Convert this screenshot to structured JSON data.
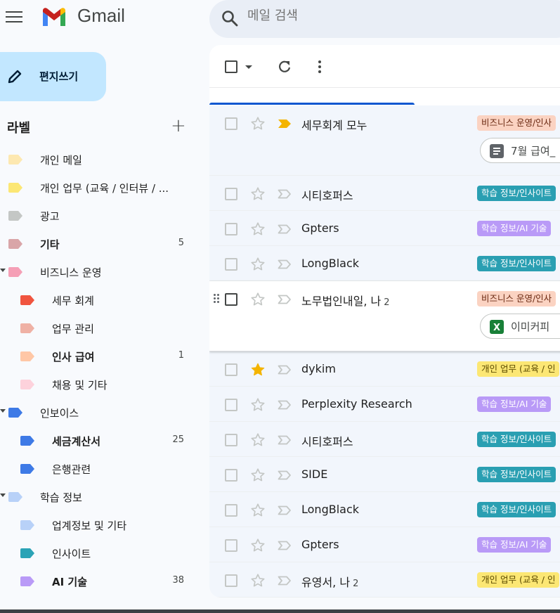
{
  "app": {
    "title": "Gmail"
  },
  "search": {
    "placeholder": "메일 검색"
  },
  "compose": {
    "label": "편지쓰기"
  },
  "labels": {
    "title": "라벨",
    "items": [
      {
        "name": "개인 메일",
        "color": "#fde8b0",
        "indent": false,
        "caret": false,
        "bold": false,
        "count": ""
      },
      {
        "name": "개인 업무 (교육 / 인터뷰 / ...",
        "color": "#fce774",
        "indent": false,
        "caret": false,
        "bold": false,
        "count": ""
      },
      {
        "name": "광고",
        "color": "#c4c7c5",
        "indent": false,
        "caret": false,
        "bold": false,
        "count": ""
      },
      {
        "name": "기타",
        "color": "#d9a5a8",
        "indent": false,
        "caret": false,
        "bold": true,
        "count": "5"
      },
      {
        "name": "비즈니스 운영",
        "color": "#f59fb6",
        "indent": false,
        "caret": true,
        "bold": false,
        "count": ""
      },
      {
        "name": "세무 회계",
        "color": "#f0543f",
        "indent": true,
        "caret": false,
        "bold": false,
        "count": ""
      },
      {
        "name": "업무 관리",
        "color": "#efb1a5",
        "indent": true,
        "caret": false,
        "bold": false,
        "count": ""
      },
      {
        "name": "인사 급여",
        "color": "#ffc7a6",
        "indent": true,
        "caret": false,
        "bold": true,
        "count": "1"
      },
      {
        "name": "채용 및 기타",
        "color": "#fdd2dc",
        "indent": true,
        "caret": false,
        "bold": false,
        "count": ""
      },
      {
        "name": "인보이스",
        "color": "#3e7ae6",
        "indent": false,
        "caret": true,
        "bold": false,
        "count": ""
      },
      {
        "name": "세금계산서",
        "color": "#3e7ae6",
        "indent": true,
        "caret": false,
        "bold": true,
        "count": "25"
      },
      {
        "name": "은행관련",
        "color": "#3e7ae6",
        "indent": true,
        "caret": false,
        "bold": false,
        "count": ""
      },
      {
        "name": "학습 정보",
        "color": "#b8d1f8",
        "indent": false,
        "caret": true,
        "bold": false,
        "count": ""
      },
      {
        "name": "업계정보 및 기타",
        "color": "#b8d1f8",
        "indent": true,
        "caret": false,
        "bold": false,
        "count": ""
      },
      {
        "name": "인사이트",
        "color": "#2ba3b6",
        "indent": true,
        "caret": false,
        "bold": false,
        "count": ""
      },
      {
        "name": "AI 기술",
        "color": "#b99af7",
        "indent": true,
        "caret": false,
        "bold": true,
        "count": "38"
      }
    ]
  },
  "emails": [
    {
      "sender": "세무회계 모누",
      "count": "",
      "starred": false,
      "important": true,
      "label": "비즈니스 운영/인사",
      "label_bg": "#fbd3c2",
      "label_fg": "#6b2a12",
      "attachment": "7월 급여_",
      "attachment_type": "doc",
      "hover": false
    },
    {
      "sender": "시티호퍼스",
      "count": "",
      "starred": false,
      "important": false,
      "label": "학습 정보/인사이트",
      "label_bg": "#2a9fb2",
      "label_fg": "#ffffff",
      "attachment": "",
      "attachment_type": "",
      "hover": false
    },
    {
      "sender": "Gpters",
      "count": "",
      "starred": false,
      "important": false,
      "label": "학습 정보/AI 기술",
      "label_bg": "#b99af7",
      "label_fg": "#ffffff",
      "attachment": "",
      "attachment_type": "",
      "hover": false
    },
    {
      "sender": "LongBlack",
      "count": "",
      "starred": false,
      "important": false,
      "label": "학습 정보/인사이트",
      "label_bg": "#2a9fb2",
      "label_fg": "#ffffff",
      "attachment": "",
      "attachment_type": "",
      "hover": false
    },
    {
      "sender": "노무법인내일, 나",
      "count": "2",
      "starred": false,
      "important": false,
      "label": "비즈니스 운영/인사",
      "label_bg": "#fbd3c2",
      "label_fg": "#6b2a12",
      "attachment": "이미커피",
      "attachment_type": "xls",
      "hover": true
    },
    {
      "sender": "dykim",
      "count": "",
      "starred": true,
      "important": false,
      "label": "개인 업무 (교육 / 인",
      "label_bg": "#fce774",
      "label_fg": "#5c4b00",
      "attachment": "",
      "attachment_type": "",
      "hover": false
    },
    {
      "sender": "Perplexity Research",
      "count": "",
      "starred": false,
      "important": false,
      "label": "학습 정보/AI 기술",
      "label_bg": "#b99af7",
      "label_fg": "#ffffff",
      "attachment": "",
      "attachment_type": "",
      "hover": false
    },
    {
      "sender": "시티호퍼스",
      "count": "",
      "starred": false,
      "important": false,
      "label": "학습 정보/인사이트",
      "label_bg": "#2a9fb2",
      "label_fg": "#ffffff",
      "attachment": "",
      "attachment_type": "",
      "hover": false
    },
    {
      "sender": "SIDE",
      "count": "",
      "starred": false,
      "important": false,
      "label": "학습 정보/인사이트",
      "label_bg": "#2a9fb2",
      "label_fg": "#ffffff",
      "attachment": "",
      "attachment_type": "",
      "hover": false
    },
    {
      "sender": "LongBlack",
      "count": "",
      "starred": false,
      "important": false,
      "label": "학습 정보/인사이트",
      "label_bg": "#2a9fb2",
      "label_fg": "#ffffff",
      "attachment": "",
      "attachment_type": "",
      "hover": false
    },
    {
      "sender": "Gpters",
      "count": "",
      "starred": false,
      "important": false,
      "label": "학습 정보/AI 기술",
      "label_bg": "#b99af7",
      "label_fg": "#ffffff",
      "attachment": "",
      "attachment_type": "",
      "hover": false
    },
    {
      "sender": "유영서, 나",
      "count": "2",
      "starred": false,
      "important": false,
      "label": "개인 업무 (교육 / 인",
      "label_bg": "#fce774",
      "label_fg": "#5c4b00",
      "attachment": "",
      "attachment_type": "",
      "hover": false
    }
  ]
}
